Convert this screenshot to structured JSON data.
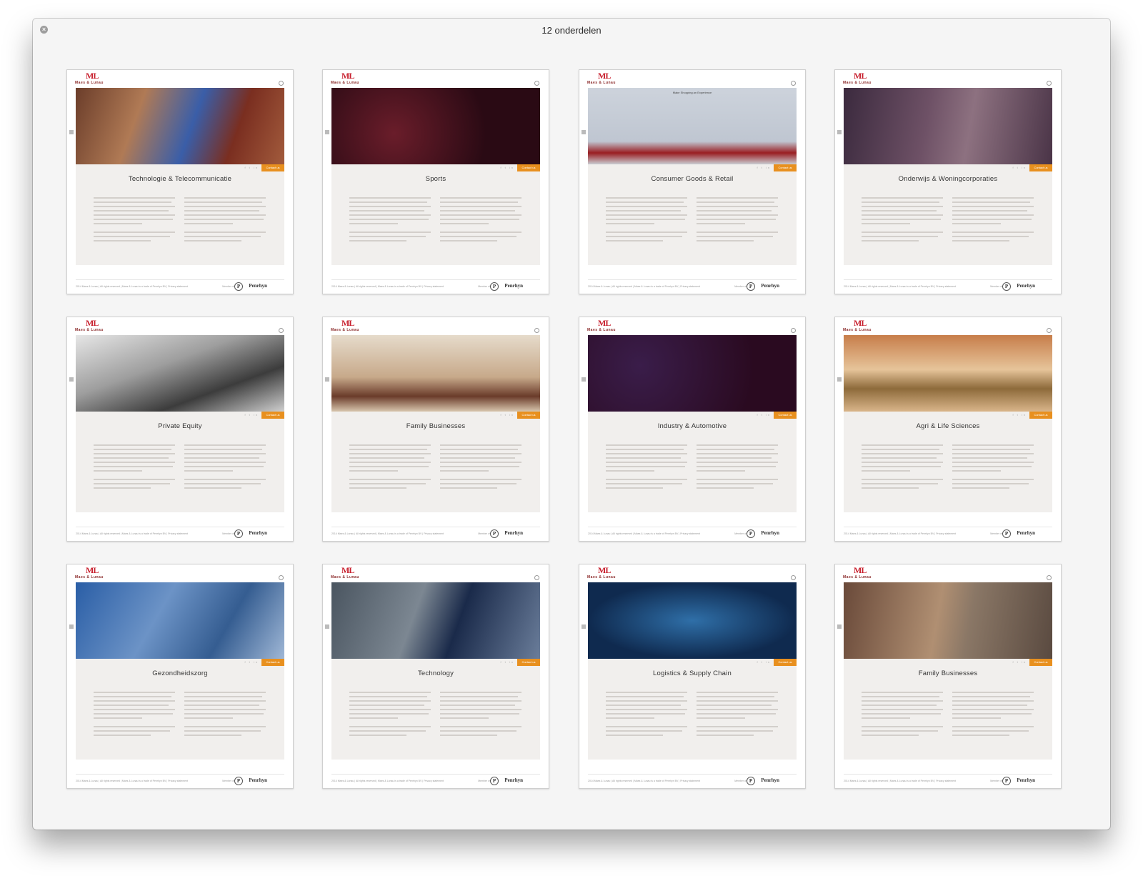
{
  "window": {
    "title": "12 onderdelen"
  },
  "brand": {
    "logo_mark": "ML",
    "logo_text": "Maes & Lunau"
  },
  "card_common": {
    "contact_label": "Contact us",
    "social_icons": [
      "facebook-icon",
      "twitter-icon",
      "linkedin-icon"
    ],
    "footer_links": "2014 Maes & Lunau   |   All rights reserved   |   Maes & Lunau is a trade of Penrhyn BV   |   Privacy statement",
    "member_label": "Member of",
    "partner_logo_mark": "P",
    "partner_logo_text": "Penrhyn"
  },
  "cards": [
    {
      "title": "Technologie & Telecommunicatie",
      "hero_caption": ""
    },
    {
      "title": "Sports",
      "hero_caption": ""
    },
    {
      "title": "Consumer Goods & Retail",
      "hero_caption": "Make Shopping an Experience"
    },
    {
      "title": "Onderwijs & Woningcorporaties",
      "hero_caption": ""
    },
    {
      "title": "Private Equity",
      "hero_caption": ""
    },
    {
      "title": "Family Businesses",
      "hero_caption": ""
    },
    {
      "title": "Industry & Automotive",
      "hero_caption": ""
    },
    {
      "title": "Agri & Life Sciences",
      "hero_caption": ""
    },
    {
      "title": "Gezondheidszorg",
      "hero_caption": ""
    },
    {
      "title": "Technology",
      "hero_caption": ""
    },
    {
      "title": "Logistics & Supply Chain",
      "hero_caption": ""
    },
    {
      "title": "Family Businesses",
      "hero_caption": ""
    }
  ]
}
